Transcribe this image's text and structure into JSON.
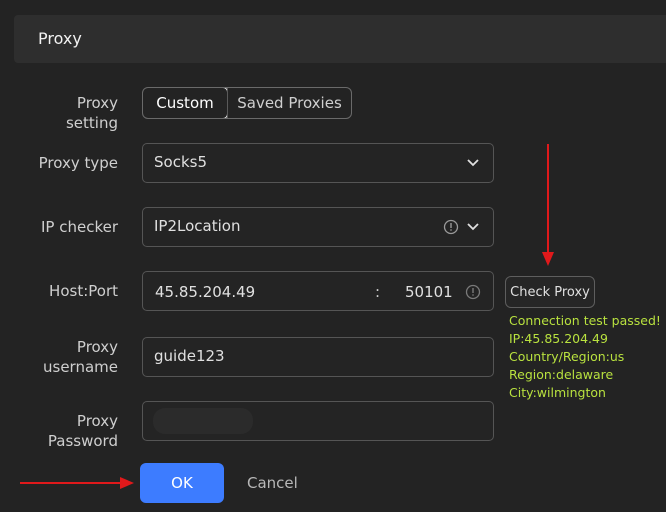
{
  "header": {
    "title": "Proxy"
  },
  "form": {
    "proxy_setting": {
      "label": "Proxy setting",
      "options": [
        "Custom",
        "Saved Proxies"
      ],
      "selected": "Custom"
    },
    "proxy_type": {
      "label": "Proxy type",
      "value": "Socks5"
    },
    "ip_checker": {
      "label": "IP checker",
      "value": "IP2Location"
    },
    "host_port": {
      "label": "Host:Port",
      "host": "45.85.204.49",
      "separator": ":",
      "port": "50101"
    },
    "proxy_username": {
      "label_line1": "Proxy",
      "label_line2": "username",
      "value": "guide123"
    },
    "proxy_password": {
      "label": "Proxy Password",
      "value": ""
    }
  },
  "check_proxy": {
    "button_label": "Check Proxy",
    "result": [
      "Connection test passed!",
      "IP:45.85.204.49",
      "Country/Region:us",
      "Region:delaware",
      "City:wilmington"
    ]
  },
  "footer": {
    "ok_label": "OK",
    "cancel_label": "Cancel"
  },
  "colors": {
    "accent": "#3d7cff",
    "success_text": "#b9e23f",
    "annotation_arrow": "#e0191b",
    "background": "#232323"
  }
}
